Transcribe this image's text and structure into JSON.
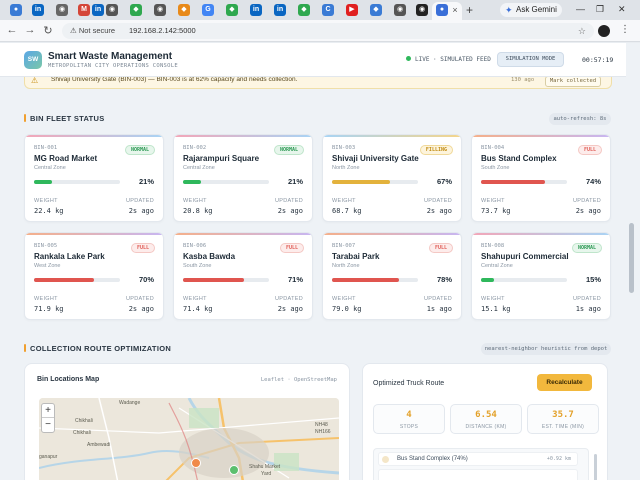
{
  "browser": {
    "new_tab": "+",
    "ask_gemini": "Ask Gemini",
    "not_secure": "Not secure",
    "url": "192.168.2.142:5000"
  },
  "header": {
    "logo": "SW",
    "title": "Smart Waste Management",
    "subtitle": "METROPOLITAN CITY OPERATIONS CONSOLE",
    "live": "LIVE · SIMULATED FEED",
    "sim_button": "SIMULATION MODE",
    "clock": "00:57:19"
  },
  "alert": {
    "text": "Shivaji University Gate (BIN-003) — BIN-003 is at 62% capacity and needs collection.",
    "time": "130 ago",
    "button": "Mark collected"
  },
  "fleet": {
    "title": "BIN FLEET STATUS",
    "refresh": "auto-refresh: 8s",
    "weight_label": "WEIGHT",
    "updated_label": "UPDATED",
    "bins": [
      {
        "id": "BIN-001",
        "name": "MG Road Market",
        "zone": "Central Zone",
        "status": "NORMAL",
        "pct": "21%",
        "level": 21,
        "weight": "22.4 kg",
        "updated": "2s ago"
      },
      {
        "id": "BIN-002",
        "name": "Rajarampuri Square",
        "zone": "Central Zone",
        "status": "NORMAL",
        "pct": "21%",
        "level": 21,
        "weight": "20.8 kg",
        "updated": "2s ago"
      },
      {
        "id": "BIN-003",
        "name": "Shivaji University Gate",
        "zone": "North Zone",
        "status": "FILLING",
        "pct": "67%",
        "level": 67,
        "weight": "68.7 kg",
        "updated": "2s ago"
      },
      {
        "id": "BIN-004",
        "name": "Bus Stand Complex",
        "zone": "South Zone",
        "status": "FULL",
        "pct": "74%",
        "level": 74,
        "weight": "73.7 kg",
        "updated": "2s ago"
      },
      {
        "id": "BIN-005",
        "name": "Rankala Lake Park",
        "zone": "West Zone",
        "status": "FULL",
        "pct": "70%",
        "level": 70,
        "weight": "71.9 kg",
        "updated": "2s ago"
      },
      {
        "id": "BIN-006",
        "name": "Kasba Bawda",
        "zone": "South Zone",
        "status": "FULL",
        "pct": "71%",
        "level": 71,
        "weight": "71.4 kg",
        "updated": "2s ago"
      },
      {
        "id": "BIN-007",
        "name": "Tarabai Park",
        "zone": "North Zone",
        "status": "FULL",
        "pct": "78%",
        "level": 78,
        "weight": "79.0 kg",
        "updated": "1s ago"
      },
      {
        "id": "BIN-008",
        "name": "Shahupuri Commercial",
        "zone": "Central Zone",
        "status": "NORMAL",
        "pct": "15%",
        "level": 15,
        "weight": "15.1 kg",
        "updated": "1s ago"
      }
    ]
  },
  "route": {
    "title": "COLLECTION ROUTE OPTIMIZATION",
    "heuristic": "nearest-neighbor heuristic from depot",
    "map_title": "Bin Locations Map",
    "map_credit": "Leaflet · OpenStreetMap",
    "zoom_in": "+",
    "zoom_out": "−",
    "map_labels": [
      "Wadange",
      "Chikhali",
      "Chikhali",
      "Ambewadi",
      "ganapur",
      "NH48",
      "NH166",
      "Shahu Market",
      "Yard"
    ],
    "truck_title": "Optimized Truck Route",
    "recalc": "Recalculate",
    "stats": [
      {
        "value": "4",
        "label": "STOPS"
      },
      {
        "value": "6.54",
        "label": "DISTANCE (KM)"
      },
      {
        "value": "35.7",
        "label": "EST. TIME (MIN)"
      }
    ],
    "first_stop": "Bus Stand Complex (74%)",
    "first_dist": "+0.92 km"
  },
  "colors": {
    "normal": "#2fb85c",
    "filling": "#e3b23c",
    "full": "#e0554f",
    "accent": "#f2b83d"
  }
}
